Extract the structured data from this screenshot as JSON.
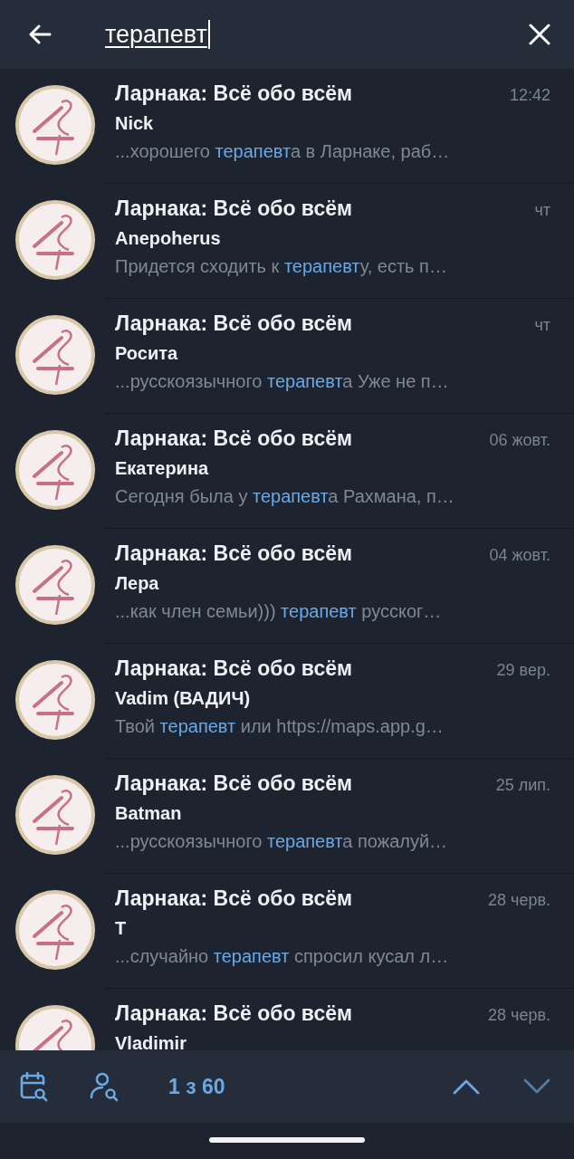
{
  "search": {
    "value": "терапевт"
  },
  "results": [
    {
      "chat": "Ларнака: Всё обо всём",
      "time": "12:42",
      "sender": "Nick",
      "before": "...хорошего ",
      "match": "терапевт",
      "after": "а в Ларнаке, раб…"
    },
    {
      "chat": "Ларнака: Всё обо всём",
      "time": "чт",
      "sender": "Anepoherus",
      "before": "Придется сходить к ",
      "match": "терапевт",
      "after": "у, есть п…"
    },
    {
      "chat": "Ларнака: Всё обо всём",
      "time": "чт",
      "sender": "Росита",
      "before": "...русскоязычного ",
      "match": "терапевт",
      "after": "а Уже не п…"
    },
    {
      "chat": "Ларнака: Всё обо всём",
      "time": "06 жовт.",
      "sender": "Екатерина",
      "before": "Сегодня была у ",
      "match": "терапевт",
      "after": "а Рахмана, п…"
    },
    {
      "chat": "Ларнака: Всё обо всём",
      "time": "04 жовт.",
      "sender": "Лера",
      "before": "...как член семьи))) ",
      "match": "терапевт",
      "after": " русског…"
    },
    {
      "chat": "Ларнака: Всё обо всём",
      "time": "29 вер.",
      "sender": "Vadim (ВАДИЧ)",
      "before": "Твой ",
      "match": "терапевт",
      "after": " или https://maps.app.g…"
    },
    {
      "chat": "Ларнака: Всё обо всём",
      "time": "25 лип.",
      "sender": "Batman",
      "before": "...русскоязычного ",
      "match": "терапевт",
      "after": "а пожалуй…"
    },
    {
      "chat": "Ларнака: Всё обо всём",
      "time": "28 черв.",
      "sender": "T",
      "before": "...случайно ",
      "match": "терапевт",
      "after": " спросил кусал л…"
    },
    {
      "chat": "Ларнака: Всё обо всём",
      "time": "28 черв.",
      "sender": "Vladimir"
    }
  ],
  "counter": "1 з 60"
}
